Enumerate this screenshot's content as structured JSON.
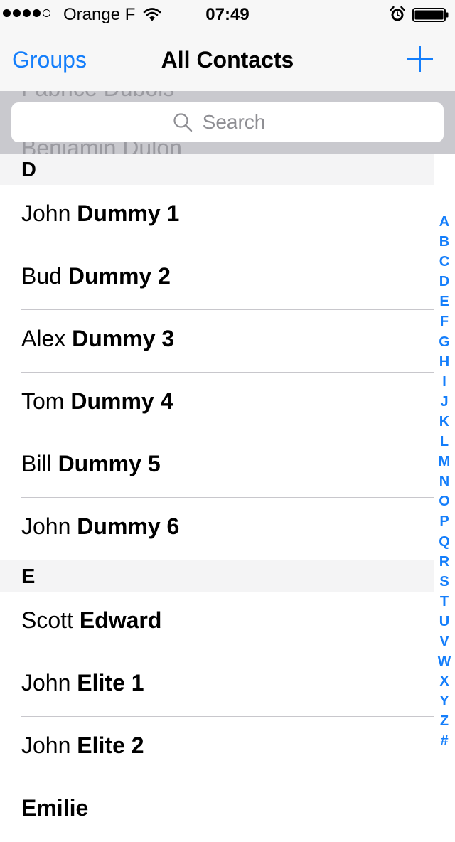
{
  "status_bar": {
    "carrier": "Orange F",
    "time": "07:49",
    "signal_filled": 4,
    "signal_total": 5
  },
  "nav": {
    "left_label": "Groups",
    "title": "All Contacts",
    "add_icon": "plus-icon"
  },
  "search": {
    "placeholder": "Search",
    "scrolled_name_above": "Fabrice Dubois",
    "scrolled_name_below": "Benjamin Dulon"
  },
  "sections": [
    {
      "letter": "D",
      "contacts": [
        {
          "first": "John",
          "last": "Dummy 1"
        },
        {
          "first": "Bud",
          "last": "Dummy 2"
        },
        {
          "first": "Alex",
          "last": "Dummy 3"
        },
        {
          "first": "Tom",
          "last": "Dummy 4"
        },
        {
          "first": "Bill",
          "last": "Dummy 5"
        },
        {
          "first": "John",
          "last": "Dummy 6"
        }
      ]
    },
    {
      "letter": "E",
      "contacts": [
        {
          "first": "Scott",
          "last": "Edward"
        },
        {
          "first": "John",
          "last": "Elite 1"
        },
        {
          "first": "John",
          "last": "Elite 2"
        },
        {
          "first": "",
          "last": "Emilie"
        }
      ]
    }
  ],
  "index": [
    "A",
    "B",
    "C",
    "D",
    "E",
    "F",
    "G",
    "H",
    "I",
    "J",
    "K",
    "L",
    "M",
    "N",
    "O",
    "P",
    "Q",
    "R",
    "S",
    "T",
    "U",
    "V",
    "W",
    "X",
    "Y",
    "Z",
    "#"
  ],
  "colors": {
    "accent": "#147efb",
    "section_bg": "#f4f4f5",
    "search_bg": "#c9c9ce",
    "separator": "#c8c7cc"
  }
}
